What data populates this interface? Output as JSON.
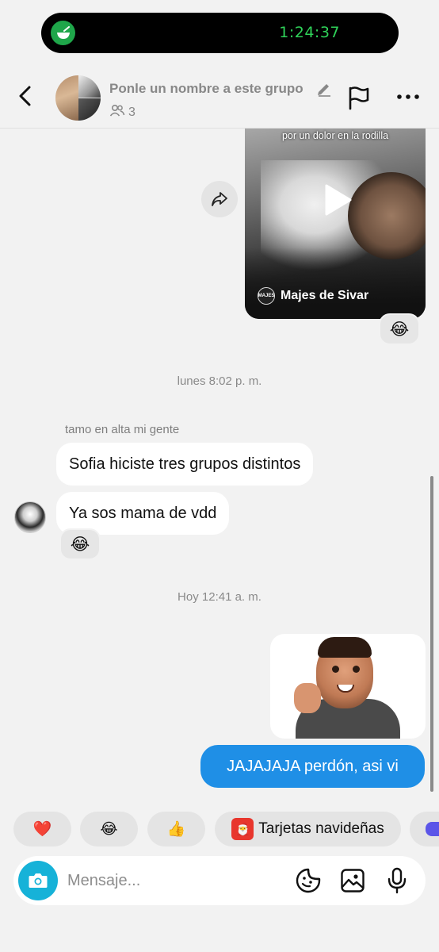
{
  "live_activity": {
    "timer": "1:24:37",
    "icon": "bowl-icon"
  },
  "header": {
    "group_name": "Ponle un nombre a este grupo",
    "member_count": "3",
    "icons": {
      "back": "chevron-left-icon",
      "edit": "pencil-icon",
      "flag": "flag-icon",
      "more": "more-horizontal-icon",
      "members": "people-icon"
    }
  },
  "messages": {
    "video": {
      "caption": "por un dolor en la rodilla",
      "source": "Majes de Sivar",
      "source_logo": "MAJES",
      "reaction": "😂"
    },
    "timestamp1": "lunes 8:02 p. m.",
    "group_in": {
      "sender": "tamo en alta mi gente",
      "texts": [
        "Sofia hiciste tres grupos distintos",
        "Ya sos mama de vdd"
      ],
      "reaction": "😂"
    },
    "timestamp2": "Hoy 12:41 a. m.",
    "outgoing": {
      "text": "JAJAJAJA perdón, asi vi"
    }
  },
  "quick_replies": [
    {
      "emoji": "❤️"
    },
    {
      "emoji": "😂"
    },
    {
      "emoji": "👍"
    },
    {
      "label": "Tarjetas navideñas",
      "emoji": "🎅"
    }
  ],
  "composer": {
    "placeholder": "Mensaje...",
    "icons": [
      "camera-icon",
      "sticker-icon",
      "gallery-icon",
      "microphone-icon"
    ]
  },
  "colors": {
    "outgoing_bubble": "#1f8fe6",
    "camera_button": "#16b2d8",
    "timer": "#2fd259"
  }
}
